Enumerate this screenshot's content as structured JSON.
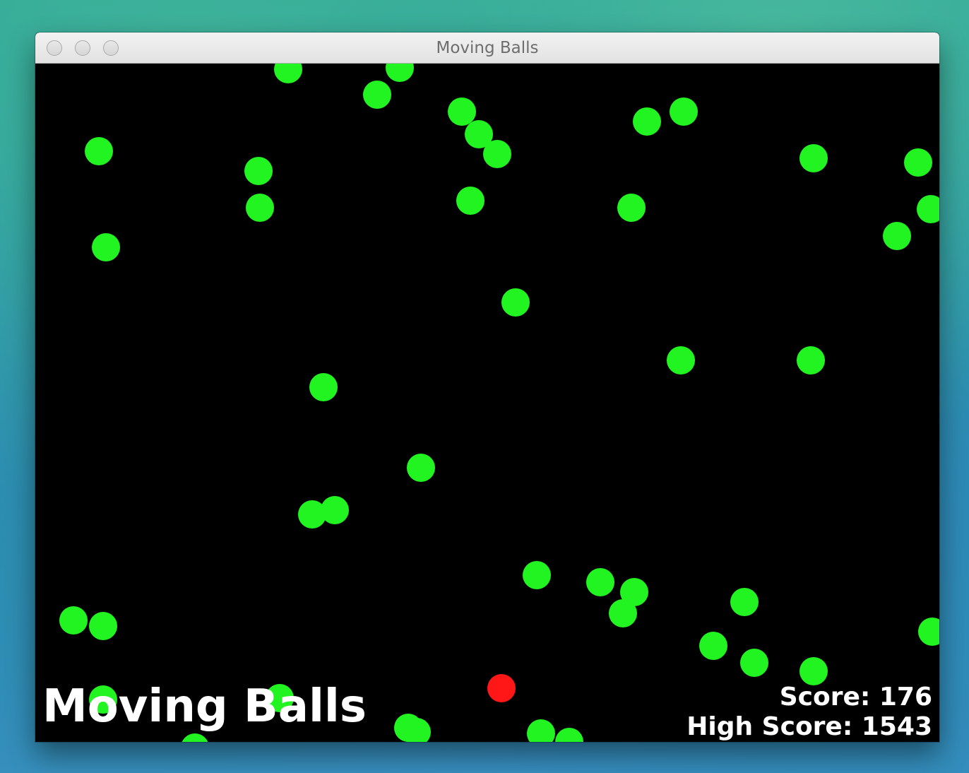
{
  "window": {
    "title": "Moving Balls"
  },
  "hud": {
    "game_title": "Moving Balls",
    "score_label": "Score:",
    "score_value": "176",
    "high_score_label": "High Score:",
    "high_score_value": "1543"
  },
  "colors": {
    "ball_green": "#22f422",
    "ball_red": "#ff1616",
    "background": "#000000",
    "text": "#ffffff"
  },
  "icons": {
    "close": "window-close-icon",
    "minimize": "window-minimize-icon",
    "zoom": "window-zoom-icon"
  }
}
